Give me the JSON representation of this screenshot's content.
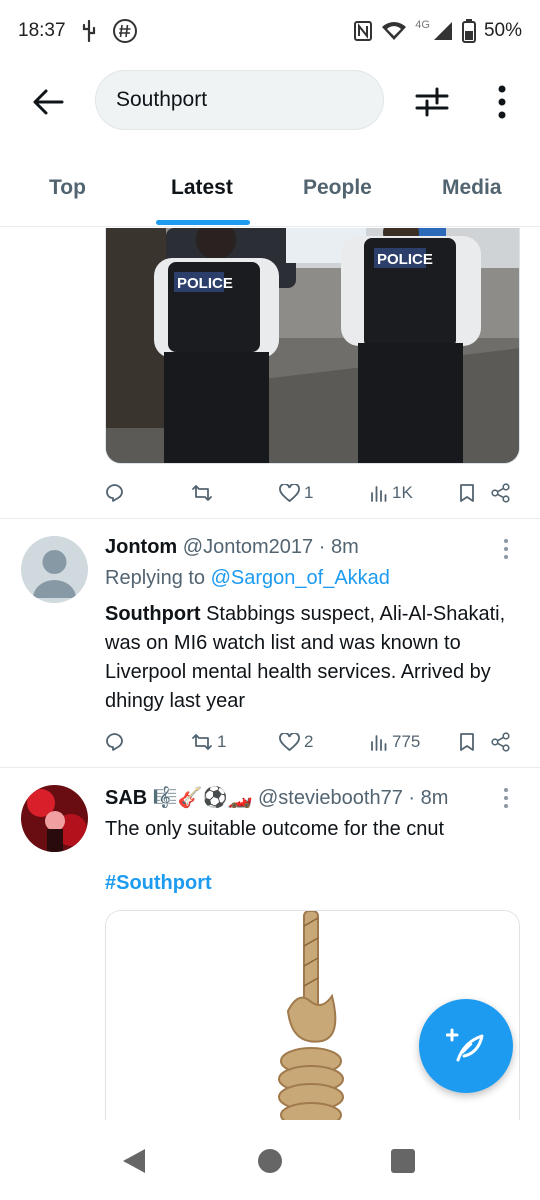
{
  "status_bar": {
    "time": "18:37",
    "network": "4G",
    "battery": "50%"
  },
  "search": {
    "query": "Southport"
  },
  "tabs": [
    {
      "label": "Top",
      "active": false
    },
    {
      "label": "Latest",
      "active": true
    },
    {
      "label": "People",
      "active": false
    },
    {
      "label": "Media",
      "active": false
    }
  ],
  "first_tweet": {
    "photo_text_1": "POLICE",
    "photo_text_2": "POLICE",
    "actions": {
      "replies": "",
      "retweets": "",
      "likes": "1",
      "views": "1K"
    }
  },
  "tweets": [
    {
      "name": "Jontom",
      "handle": "@Jontom2017",
      "time": "· 8m",
      "replying_prefix": "Replying to ",
      "replying_to": "@Sargon_of_Akkad",
      "body_bold": "Southport",
      "body_rest": " Stabbings suspect, Ali-Al-Shakati,  was on MI6 watch list and was known to Liverpool mental health services. Arrived by dhingy last year",
      "actions": {
        "replies": "",
        "retweets": "1",
        "likes": "2",
        "views": "775"
      }
    },
    {
      "name": "SAB 🎼🎸⚽🏎️",
      "handle": "@steviebooth77",
      "time": "· 8m",
      "body": "The only suitable outcome for the cnut",
      "hashtag": "#Southport"
    }
  ],
  "colors": {
    "accent": "#1d9bf0",
    "text_primary": "#0f1419",
    "text_secondary": "#536471"
  }
}
